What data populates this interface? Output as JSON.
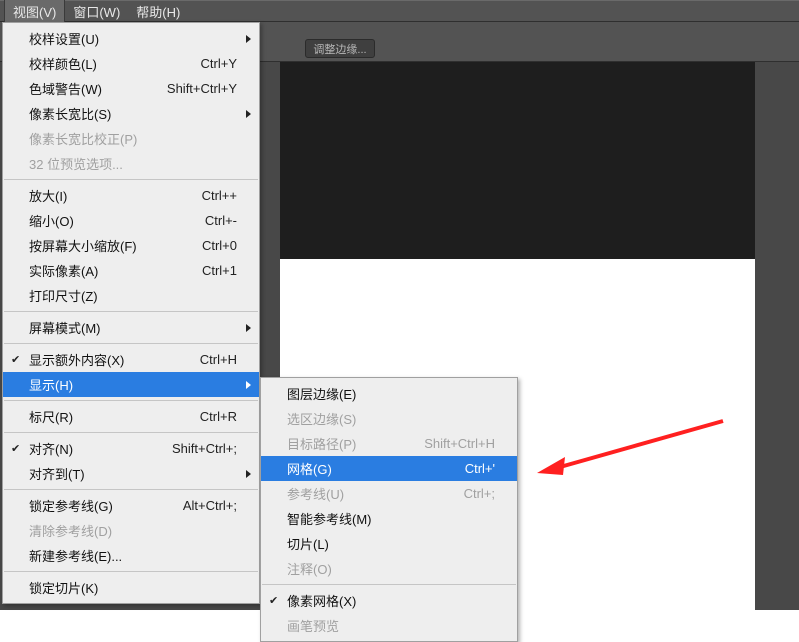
{
  "menubar": {
    "view": "视图(V)",
    "window": "窗口(W)",
    "help": "帮助(H)"
  },
  "toolbar": {
    "adjust_edge": "调整边缘..."
  },
  "menu": {
    "proof_setup": "校样设置(U)",
    "proof_colors": "校样颜色(L)",
    "proof_colors_key": "Ctrl+Y",
    "gamut_warning": "色域警告(W)",
    "gamut_warning_key": "Shift+Ctrl+Y",
    "pixel_aspect": "像素长宽比(S)",
    "pixel_aspect_correction": "像素长宽比校正(P)",
    "preview_32bit": "32 位预览选项...",
    "zoom_in": "放大(I)",
    "zoom_in_key": "Ctrl++",
    "zoom_out": "缩小(O)",
    "zoom_out_key": "Ctrl+-",
    "fit_screen": "按屏幕大小缩放(F)",
    "fit_screen_key": "Ctrl+0",
    "actual_pixels": "实际像素(A)",
    "actual_pixels_key": "Ctrl+1",
    "print_size": "打印尺寸(Z)",
    "screen_mode": "屏幕模式(M)",
    "show_extras": "显示额外内容(X)",
    "show_extras_key": "Ctrl+H",
    "show": "显示(H)",
    "rulers": "标尺(R)",
    "rulers_key": "Ctrl+R",
    "snap": "对齐(N)",
    "snap_key": "Shift+Ctrl+;",
    "snap_to": "对齐到(T)",
    "lock_guides": "锁定参考线(G)",
    "lock_guides_key": "Alt+Ctrl+;",
    "clear_guides": "清除参考线(D)",
    "new_guide": "新建参考线(E)...",
    "lock_slices": "锁定切片(K)"
  },
  "submenu": {
    "layer_edges": "图层边缘(E)",
    "selection_edges": "选区边缘(S)",
    "target_path": "目标路径(P)",
    "target_path_key": "Shift+Ctrl+H",
    "grid": "网格(G)",
    "grid_key": "Ctrl+'",
    "guides": "参考线(U)",
    "guides_key": "Ctrl+;",
    "smart_guides": "智能参考线(M)",
    "slices": "切片(L)",
    "notes": "注释(O)",
    "pixel_grid": "像素网格(X)",
    "preview": "画笔预览"
  }
}
